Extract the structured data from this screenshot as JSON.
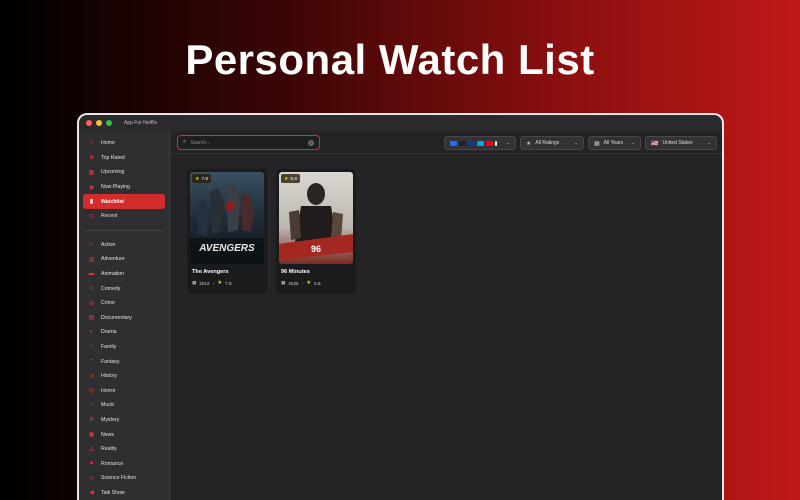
{
  "headline": "Personal Watch List",
  "window": {
    "app_title": "App For Netflix"
  },
  "sidebar": {
    "nav": [
      {
        "label": "Home",
        "icon": "home-icon"
      },
      {
        "label": "Top Rated",
        "icon": "star-icon"
      },
      {
        "label": "Upcoming",
        "icon": "calendar-icon"
      },
      {
        "label": "Now Playing",
        "icon": "play-icon"
      },
      {
        "label": "Watchlist",
        "icon": "bookmark-icon",
        "active": true
      },
      {
        "label": "Recent",
        "icon": "clock-icon"
      }
    ],
    "genres": [
      {
        "label": "Action",
        "icon": "flame-icon"
      },
      {
        "label": "Adventure",
        "icon": "map-icon"
      },
      {
        "label": "Animation",
        "icon": "animation-icon"
      },
      {
        "label": "Comedy",
        "icon": "smile-icon"
      },
      {
        "label": "Crime",
        "icon": "crime-icon"
      },
      {
        "label": "Documentary",
        "icon": "book-icon"
      },
      {
        "label": "Drama",
        "icon": "masks-icon"
      },
      {
        "label": "Family",
        "icon": "family-icon"
      },
      {
        "label": "Fantasy",
        "icon": "wand-icon"
      },
      {
        "label": "History",
        "icon": "history-icon"
      },
      {
        "label": "Horror",
        "icon": "eye-icon"
      },
      {
        "label": "Music",
        "icon": "music-note-icon"
      },
      {
        "label": "Mystery",
        "icon": "mystery-icon"
      },
      {
        "label": "News",
        "icon": "news-icon"
      },
      {
        "label": "Reality",
        "icon": "person-icon"
      },
      {
        "label": "Romance",
        "icon": "heart-icon"
      },
      {
        "label": "Science Fiction",
        "icon": "atom-icon"
      },
      {
        "label": "Talk Show",
        "icon": "megaphone-icon"
      }
    ]
  },
  "toolbar": {
    "search_placeholder": "Search...",
    "ratings_label": "All Ratings",
    "years_label": "All Years",
    "country_label": "United States",
    "country_flag": "🇺🇸"
  },
  "movies": [
    {
      "title": "The Avengers",
      "year": "2012",
      "rating": "7.9",
      "badge": "7.9"
    },
    {
      "title": "96 Minutes",
      "year": "2025",
      "rating": "5.8",
      "badge": "5.8"
    }
  ],
  "colors": {
    "accent": "#d42b2b",
    "star": "#f5c518"
  }
}
